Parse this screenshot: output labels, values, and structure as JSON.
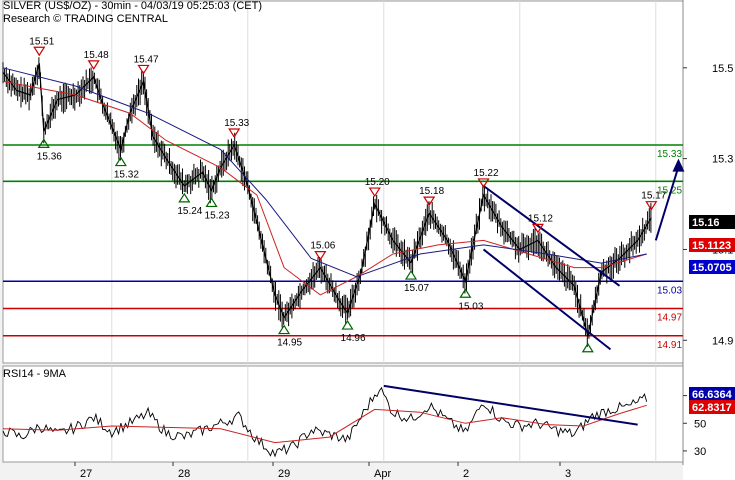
{
  "header": {
    "title": "SILVER (US$/OZ) - 30min - 04/03/19 05:25:03 (CET)",
    "credit": "Research © TRADING CENTRAL"
  },
  "chart_data": [
    {
      "type": "line",
      "panel": "price",
      "instrument": "SILVER (US$/OZ)",
      "timeframe": "30min",
      "y_ticks": [
        14.9,
        15.1,
        15.3,
        15.5
      ],
      "ylim": [
        14.85,
        15.57
      ],
      "x_ticks": [
        "27",
        "28",
        "29",
        "Apr",
        "2",
        "3"
      ],
      "horizontal_levels": [
        {
          "value": 15.33,
          "label": "15.33",
          "color": "#008000"
        },
        {
          "value": 15.25,
          "label": "15.25",
          "color": "#008000"
        },
        {
          "value": 15.03,
          "label": "15.03",
          "color": "#0000aa"
        },
        {
          "value": 14.97,
          "label": "14.97",
          "color": "#cc0000"
        },
        {
          "value": 14.91,
          "label": "14.91",
          "color": "#cc0000"
        }
      ],
      "swing_labels": [
        {
          "type": "high",
          "value": 15.51,
          "label": "15.51"
        },
        {
          "type": "low",
          "value": 15.36,
          "label": "15.36"
        },
        {
          "type": "high",
          "value": 15.48,
          "label": "15.48"
        },
        {
          "type": "low",
          "value": 15.32,
          "label": "15.32"
        },
        {
          "type": "high",
          "value": 15.47,
          "label": "15.47"
        },
        {
          "type": "low",
          "value": 15.24,
          "label": "15.24"
        },
        {
          "type": "low",
          "value": 15.23,
          "label": "15.23"
        },
        {
          "type": "high",
          "value": 15.33,
          "label": "15.33"
        },
        {
          "type": "low",
          "value": 14.95,
          "label": "14.95"
        },
        {
          "type": "high",
          "value": 15.06,
          "label": "15.06"
        },
        {
          "type": "low",
          "value": 14.96,
          "label": "14.96"
        },
        {
          "type": "high",
          "value": 15.2,
          "label": "15.20"
        },
        {
          "type": "low",
          "value": 15.07,
          "label": "15.07"
        },
        {
          "type": "high",
          "value": 15.18,
          "label": "15.18"
        },
        {
          "type": "low",
          "value": 15.03,
          "label": "15.03"
        },
        {
          "type": "high",
          "value": 15.22,
          "label": "15.22"
        },
        {
          "type": "high",
          "value": 15.12,
          "label": "15.12"
        },
        {
          "type": "low",
          "value": 14.91,
          "label": ""
        },
        {
          "type": "high",
          "value": 15.17,
          "label": "15.17"
        }
      ],
      "price_series": [
        {
          "t": 0,
          "v": 15.49
        },
        {
          "t": 1.5,
          "v": 15.45
        },
        {
          "t": 3,
          "v": 15.44
        },
        {
          "t": 4,
          "v": 15.51
        },
        {
          "t": 4.5,
          "v": 15.36
        },
        {
          "t": 6,
          "v": 15.43
        },
        {
          "t": 8,
          "v": 15.44
        },
        {
          "t": 10,
          "v": 15.48
        },
        {
          "t": 11,
          "v": 15.42
        },
        {
          "t": 13,
          "v": 15.32
        },
        {
          "t": 14,
          "v": 15.4
        },
        {
          "t": 15.5,
          "v": 15.47
        },
        {
          "t": 16.5,
          "v": 15.35
        },
        {
          "t": 18,
          "v": 15.3
        },
        {
          "t": 20,
          "v": 15.24
        },
        {
          "t": 22,
          "v": 15.27
        },
        {
          "t": 23,
          "v": 15.23
        },
        {
          "t": 24,
          "v": 15.28
        },
        {
          "t": 25.5,
          "v": 15.33
        },
        {
          "t": 27,
          "v": 15.24
        },
        {
          "t": 28.5,
          "v": 15.12
        },
        {
          "t": 30,
          "v": 15.0
        },
        {
          "t": 31,
          "v": 14.95
        },
        {
          "t": 33,
          "v": 15.01
        },
        {
          "t": 35,
          "v": 15.06
        },
        {
          "t": 37,
          "v": 14.99
        },
        {
          "t": 38,
          "v": 14.96
        },
        {
          "t": 39.5,
          "v": 15.05
        },
        {
          "t": 41,
          "v": 15.2
        },
        {
          "t": 43,
          "v": 15.12
        },
        {
          "t": 45,
          "v": 15.07
        },
        {
          "t": 47,
          "v": 15.18
        },
        {
          "t": 49,
          "v": 15.12
        },
        {
          "t": 51,
          "v": 15.03
        },
        {
          "t": 53,
          "v": 15.22
        },
        {
          "t": 55,
          "v": 15.15
        },
        {
          "t": 57,
          "v": 15.1
        },
        {
          "t": 59,
          "v": 15.12
        },
        {
          "t": 61,
          "v": 15.06
        },
        {
          "t": 63,
          "v": 15.02
        },
        {
          "t": 64.5,
          "v": 14.91
        },
        {
          "t": 66,
          "v": 15.05
        },
        {
          "t": 68,
          "v": 15.08
        },
        {
          "t": 70,
          "v": 15.12
        },
        {
          "t": 71.5,
          "v": 15.17
        }
      ],
      "moving_average_1": [
        {
          "t": 0,
          "v": 15.47
        },
        {
          "t": 8,
          "v": 15.44
        },
        {
          "t": 14,
          "v": 15.4
        },
        {
          "t": 18,
          "v": 15.34
        },
        {
          "t": 24,
          "v": 15.28
        },
        {
          "t": 28,
          "v": 15.22
        },
        {
          "t": 31,
          "v": 15.06
        },
        {
          "t": 35,
          "v": 15.0
        },
        {
          "t": 39,
          "v": 15.04
        },
        {
          "t": 43,
          "v": 15.09
        },
        {
          "t": 48,
          "v": 15.11
        },
        {
          "t": 53,
          "v": 15.12
        },
        {
          "t": 58,
          "v": 15.09
        },
        {
          "t": 63,
          "v": 15.06
        },
        {
          "t": 66,
          "v": 15.06
        },
        {
          "t": 71,
          "v": 15.09
        }
      ],
      "moving_average_2": [
        {
          "t": 0,
          "v": 15.5
        },
        {
          "t": 8,
          "v": 15.46
        },
        {
          "t": 16,
          "v": 15.4
        },
        {
          "t": 24,
          "v": 15.32
        },
        {
          "t": 29,
          "v": 15.21
        },
        {
          "t": 34,
          "v": 15.08
        },
        {
          "t": 39,
          "v": 15.04
        },
        {
          "t": 46,
          "v": 15.09
        },
        {
          "t": 53,
          "v": 15.11
        },
        {
          "t": 60,
          "v": 15.09
        },
        {
          "t": 66,
          "v": 15.07
        },
        {
          "t": 71,
          "v": 15.09
        }
      ],
      "trend_channel": [
        {
          "t1": 53,
          "v1": 15.24,
          "t2": 68,
          "v2": 15.02
        },
        {
          "t1": 53,
          "v1": 15.1,
          "t2": 67,
          "v2": 14.88
        }
      ],
      "projection_arrow": {
        "t1": 72,
        "v1": 15.12,
        "t2": 74.5,
        "v2": 15.3
      },
      "value_boxes": [
        {
          "value": 15.16,
          "label": "15.16",
          "bg": "#000000",
          "fg": "#ffffff"
        },
        {
          "value": 15.1123,
          "label": "15.1123",
          "bg": "#dd0000",
          "fg": "#ffffff"
        },
        {
          "value": 15.0705,
          "label": "15.0705",
          "bg": "#0000cc",
          "fg": "#ffffff"
        }
      ]
    },
    {
      "type": "line",
      "panel": "indicator",
      "title": "RSI14 - 9MA",
      "y_ticks": [
        30,
        50,
        70
      ],
      "ylim": [
        22,
        82
      ],
      "rsi_series": [
        {
          "t": 0,
          "v": 45
        },
        {
          "t": 2,
          "v": 40
        },
        {
          "t": 4,
          "v": 48
        },
        {
          "t": 6,
          "v": 42
        },
        {
          "t": 8,
          "v": 47
        },
        {
          "t": 10,
          "v": 54
        },
        {
          "t": 12,
          "v": 44
        },
        {
          "t": 14,
          "v": 50
        },
        {
          "t": 16,
          "v": 57
        },
        {
          "t": 18,
          "v": 43
        },
        {
          "t": 20,
          "v": 40
        },
        {
          "t": 22,
          "v": 45
        },
        {
          "t": 24,
          "v": 50
        },
        {
          "t": 26,
          "v": 55
        },
        {
          "t": 28,
          "v": 38
        },
        {
          "t": 30,
          "v": 28
        },
        {
          "t": 32,
          "v": 33
        },
        {
          "t": 34,
          "v": 45
        },
        {
          "t": 36,
          "v": 42
        },
        {
          "t": 38,
          "v": 38
        },
        {
          "t": 40,
          "v": 60
        },
        {
          "t": 41.5,
          "v": 76
        },
        {
          "t": 43,
          "v": 58
        },
        {
          "t": 45,
          "v": 53
        },
        {
          "t": 47,
          "v": 63
        },
        {
          "t": 49,
          "v": 52
        },
        {
          "t": 51,
          "v": 43
        },
        {
          "t": 53,
          "v": 66
        },
        {
          "t": 55,
          "v": 52
        },
        {
          "t": 57,
          "v": 48
        },
        {
          "t": 59,
          "v": 50
        },
        {
          "t": 61,
          "v": 45
        },
        {
          "t": 63,
          "v": 42
        },
        {
          "t": 65,
          "v": 55
        },
        {
          "t": 67,
          "v": 60
        },
        {
          "t": 69,
          "v": 62
        },
        {
          "t": 71,
          "v": 68
        }
      ],
      "rsi_ma_series": [
        {
          "t": 0,
          "v": 46
        },
        {
          "t": 6,
          "v": 45
        },
        {
          "t": 12,
          "v": 48
        },
        {
          "t": 18,
          "v": 47
        },
        {
          "t": 24,
          "v": 46
        },
        {
          "t": 30,
          "v": 36
        },
        {
          "t": 36,
          "v": 40
        },
        {
          "t": 41,
          "v": 60
        },
        {
          "t": 46,
          "v": 58
        },
        {
          "t": 51,
          "v": 50
        },
        {
          "t": 55,
          "v": 54
        },
        {
          "t": 60,
          "v": 49
        },
        {
          "t": 64,
          "v": 48
        },
        {
          "t": 68,
          "v": 57
        },
        {
          "t": 71,
          "v": 63
        }
      ],
      "trendline": {
        "t1": 42,
        "v1": 77,
        "t2": 70,
        "v2": 49
      },
      "value_boxes": [
        {
          "value": 66.6364,
          "label": "66.6364",
          "bg": "#0000aa",
          "fg": "#ffffff"
        },
        {
          "value": 62.8317,
          "label": "62.8317",
          "bg": "#dd0000",
          "fg": "#ffffff"
        }
      ]
    }
  ]
}
